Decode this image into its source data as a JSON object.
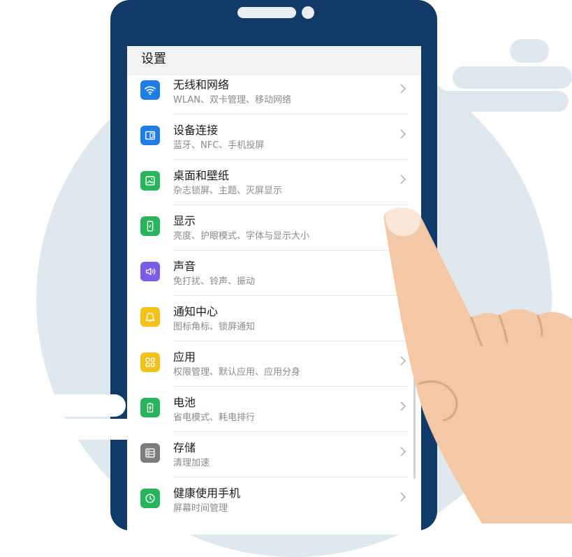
{
  "screen": {
    "title": "设置",
    "items": [
      {
        "label": "无线和网络",
        "sub": "WLAN、双卡管理、移动网络",
        "icon": "wifi-icon",
        "color": "#1f7ee6"
      },
      {
        "label": "设备连接",
        "sub": "蓝牙、NFC、手机投屏",
        "icon": "device-connection-icon",
        "color": "#1f7ee6"
      },
      {
        "label": "桌面和壁纸",
        "sub": "杂志锁屏、主题、灭屏显示",
        "icon": "wallpaper-icon",
        "color": "#27b45b"
      },
      {
        "label": "显示",
        "sub": "亮度、护眼模式、字体与显示大小",
        "icon": "display-icon",
        "color": "#27b45b"
      },
      {
        "label": "声音",
        "sub": "免打扰、铃声、振动",
        "icon": "sound-icon",
        "color": "#7a5de6"
      },
      {
        "label": "通知中心",
        "sub": "图标角标、锁屏通知",
        "icon": "bell-icon",
        "color": "#f2c21a"
      },
      {
        "label": "应用",
        "sub": "权限管理、默认应用、应用分身",
        "icon": "apps-icon",
        "color": "#f2c21a"
      },
      {
        "label": "电池",
        "sub": "省电模式、耗电排行",
        "icon": "battery-icon",
        "color": "#27b45b"
      },
      {
        "label": "存储",
        "sub": "清理加速",
        "icon": "storage-icon",
        "color": "#7d7d7d"
      },
      {
        "label": "健康使用手机",
        "sub": "屏幕时间管理",
        "icon": "health-icon",
        "color": "#27b45b"
      }
    ]
  },
  "colors": {
    "phone_frame": "#123a66",
    "background_circle": "#dfe8ec",
    "hand": "#f3c8a6"
  }
}
